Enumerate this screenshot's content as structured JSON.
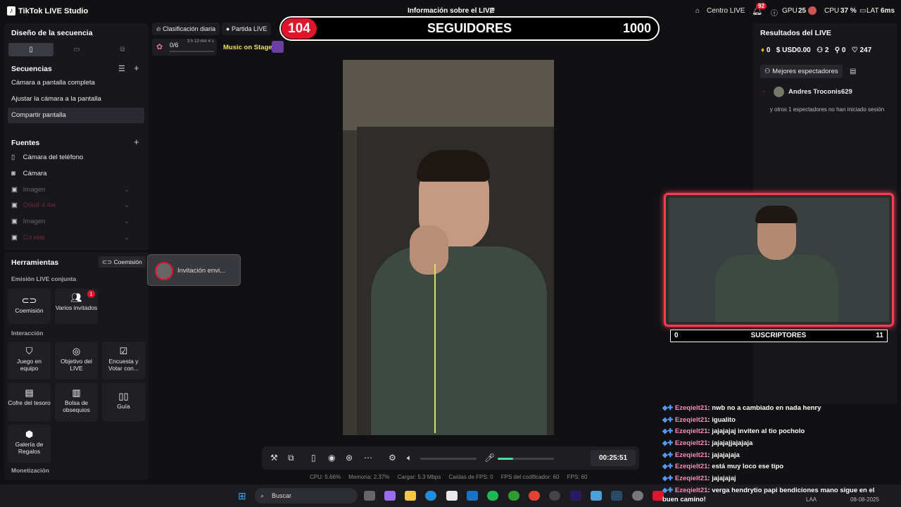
{
  "app": {
    "title": "TikTok LIVE Studio",
    "live_info": "Información sobre el LIVE"
  },
  "topbar": {
    "centro_live": "Centro LIVE",
    "notif_count": "92",
    "gpu_label": "GPU",
    "gpu_value": "25",
    "cpu_label": "CPU",
    "cpu_value": "37 %",
    "lat_label": "LAT",
    "lat_value": "6ms"
  },
  "left": {
    "layout_title": "Diseño de la secuencia",
    "sequences_title": "Secuencias",
    "sequences": [
      "Cámara a pantalla completa",
      "Ajustar la cámara a la pantalla",
      "Compartir pantalla"
    ],
    "sources_title": "Fuentes",
    "sources": [
      {
        "label": "Cámara del teléfono",
        "icon": "phone-camera-icon"
      },
      {
        "label": "Cámara",
        "icon": "camera-icon"
      },
      {
        "label": "Imagen",
        "icon": "image-icon"
      },
      {
        "label": "Обой 4 4м",
        "icon": "image-icon"
      },
      {
        "label": "Imagen",
        "icon": "image-icon"
      },
      {
        "label": "Сл кмв",
        "icon": "image-icon"
      }
    ],
    "tools_title": "Herramientas",
    "coemision_link": "Coemisión",
    "joint_title": "Emisión LIVE conjunta",
    "joint_tools": [
      {
        "label": "Coemisión"
      },
      {
        "label": "Varios invitados",
        "badge": "1"
      }
    ],
    "interaction_title": "Interacción",
    "interaction_tools": [
      "Juego en equipo",
      "Objetivo del LIVE",
      "Encuesta y Votar con...",
      "Cofre del tesoro",
      "Bolsa de obsequios",
      "Guía",
      "Galería de Regalos"
    ],
    "monetization_title": "Monetización"
  },
  "invite_popup": {
    "text": "Invitación envi..."
  },
  "overlay": {
    "daily_rank": "Clasificación diaria",
    "live_match": "Partida LIVE",
    "progress": "0/6",
    "progress_time": "3 h 13 min 4 s",
    "music_on_stage": "Music on Stage",
    "followers_count": "104",
    "followers_label": "SEGUIDORES",
    "followers_goal": "1000"
  },
  "right": {
    "results_title": "Resultados del LIVE",
    "stats": [
      {
        "icon": "diamond-icon",
        "value": "0"
      },
      {
        "icon": "dollar-icon",
        "value": "USD0.00"
      },
      {
        "icon": "viewers-icon",
        "value": "2"
      },
      {
        "icon": "new-followers-icon",
        "value": "0"
      },
      {
        "icon": "heart-icon",
        "value": "247"
      }
    ],
    "top_viewers_tab": "Mejores espectadores",
    "rank_dash": "-",
    "top_viewer_name": "Andres Troconis629",
    "others_note": "y otros 1 espectadores no han iniciado sesión"
  },
  "subs": {
    "left": "0",
    "label": "SUSCRIPTORES",
    "right": "11"
  },
  "chat": [
    {
      "user": "Ezeqielt21",
      "msg": ": nwb no a cambiado en nada henry"
    },
    {
      "user": "Ezeqielt21",
      "msg": ": igualito"
    },
    {
      "user": "Ezeqielt21",
      "msg": ": jajajajaj inviten al tio pocholo"
    },
    {
      "user": "Ezeqielt21",
      "msg": ": jajajajjajajaja"
    },
    {
      "user": "Ezeqielt21",
      "msg": ": jajajajaja"
    },
    {
      "user": "Ezeqielt21",
      "msg": ": está muy loco ese tipo"
    },
    {
      "user": "Ezeqielt21",
      "msg": ": jajajajaj"
    },
    {
      "user": "Ezeqielt21",
      "msg": ": verga hendrytio papi bendiciones mano sigue en el buen",
      "cont": "camino!"
    }
  ],
  "controls": {
    "timer": "00:25:51",
    "volume": 0.0,
    "mic_level": 0.28
  },
  "stats": {
    "cpu": "CPU:  5.66%",
    "mem": "Memoria:  2.37%",
    "load": "Cargar:  5.3 Mbps",
    "drops": "Caídas de FPS:  0",
    "enc_fps": "FPS del codificador:  60",
    "fps": "FPS:  60"
  },
  "taskbar": {
    "search": "Buscar",
    "lang": "LAA",
    "date": "08-08-2025"
  }
}
